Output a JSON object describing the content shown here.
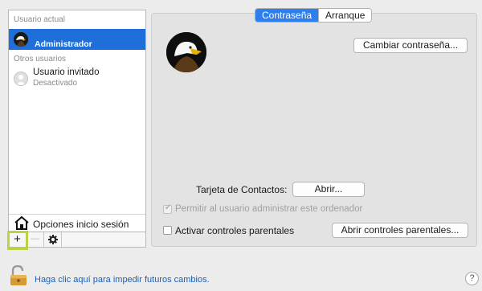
{
  "users_list": {
    "current_user_section": "Usuario actual",
    "current_user": {
      "name": "Administrador"
    },
    "other_users_section": "Otros usuarios",
    "other_users": [
      {
        "name": "Usuario invitado",
        "status": "Desactivado"
      }
    ],
    "login_options": "Opciones inicio sesión"
  },
  "list_controls": {
    "add": "+",
    "remove": "—",
    "actions_icon": "gear-icon"
  },
  "tabs": [
    {
      "label": "Contraseña",
      "active": true
    },
    {
      "label": "Arranque",
      "active": false
    }
  ],
  "password_panel": {
    "change_password_button": "Cambiar contraseña...",
    "contact_card_label": "Tarjeta de Contactos:",
    "open_button": "Abrir...",
    "allow_admin_label": "Permitir al usuario administrar este ordenador",
    "allow_admin_checked": true,
    "allow_admin_disabled": true,
    "parental_controls_label": "Activar controles parentales",
    "parental_controls_checked": false,
    "open_parental_button": "Abrir controles parentales..."
  },
  "footer": {
    "lock_icon": "lock-open-icon",
    "lock_text": "Haga clic aquí para impedir futuros cambios.",
    "help": "?"
  },
  "colors": {
    "selection": "#1e6fd9",
    "active_tab": "#2d7ff0",
    "highlight": "#b8d344",
    "link": "#1c5fb5"
  }
}
